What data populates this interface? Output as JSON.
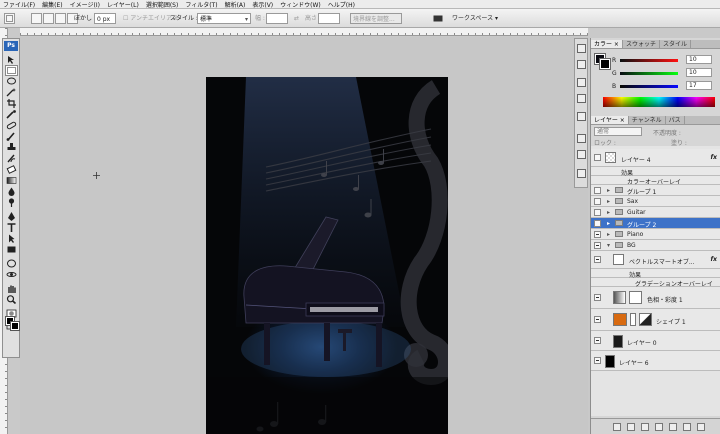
{
  "menu": [
    "ファイル(F)",
    "編集(E)",
    "イメージ(I)",
    "レイヤー(L)",
    "選択範囲(S)",
    "フィルタ(T)",
    "解析(A)",
    "表示(V)",
    "ウィンドウ(W)",
    "ヘルプ(H)"
  ],
  "options": {
    "feather_label": "ぼかし :",
    "feather_value": "0 px",
    "antialias_label": "アンチエイリアス",
    "style_label": "スタイル :",
    "style_value": "標準",
    "width_label": "幅 :",
    "height_label": "高さ :",
    "refine_edge_label": "境界線を調整...",
    "workspace_label": "ワークスペース ▾"
  },
  "toolbar": {
    "logo": "Ps"
  },
  "color_panel": {
    "tabs": [
      "カラー ×",
      "スウォッチ",
      "スタイル"
    ],
    "r_label": "R",
    "g_label": "G",
    "b_label": "B",
    "r_value": "10",
    "g_value": "10",
    "b_value": "17"
  },
  "layers_panel": {
    "tabs": [
      "レイヤー ×",
      "チャンネル",
      "パス"
    ],
    "blend_mode": "通常",
    "opacity_label": "不透明度 :",
    "lock_label": "ロック :",
    "fill_label": "塗り :",
    "layers": [
      {
        "name": "レイヤー 4",
        "fx": "fx"
      },
      {
        "name": "効果"
      },
      {
        "name": "カラーオーバーレイ"
      },
      {
        "name": "グループ 1"
      },
      {
        "name": "Sax"
      },
      {
        "name": "Guitar"
      },
      {
        "name": "グループ 2"
      },
      {
        "name": "Piano"
      },
      {
        "name": "BG"
      },
      {
        "name": "ベクトルスマートオブ...",
        "fx": "fx"
      },
      {
        "name": "効果"
      },
      {
        "name": "グラデーションオーバーレイ"
      },
      {
        "name": "色相・彩度 1"
      },
      {
        "name": "シェイプ 1"
      },
      {
        "name": "レイヤー 0"
      },
      {
        "name": "レイヤー 6"
      }
    ]
  },
  "colors": {
    "selected_layer": "#3d72c8",
    "ps_blue": "#2a66b8",
    "shape_fill": "#d86a10"
  }
}
